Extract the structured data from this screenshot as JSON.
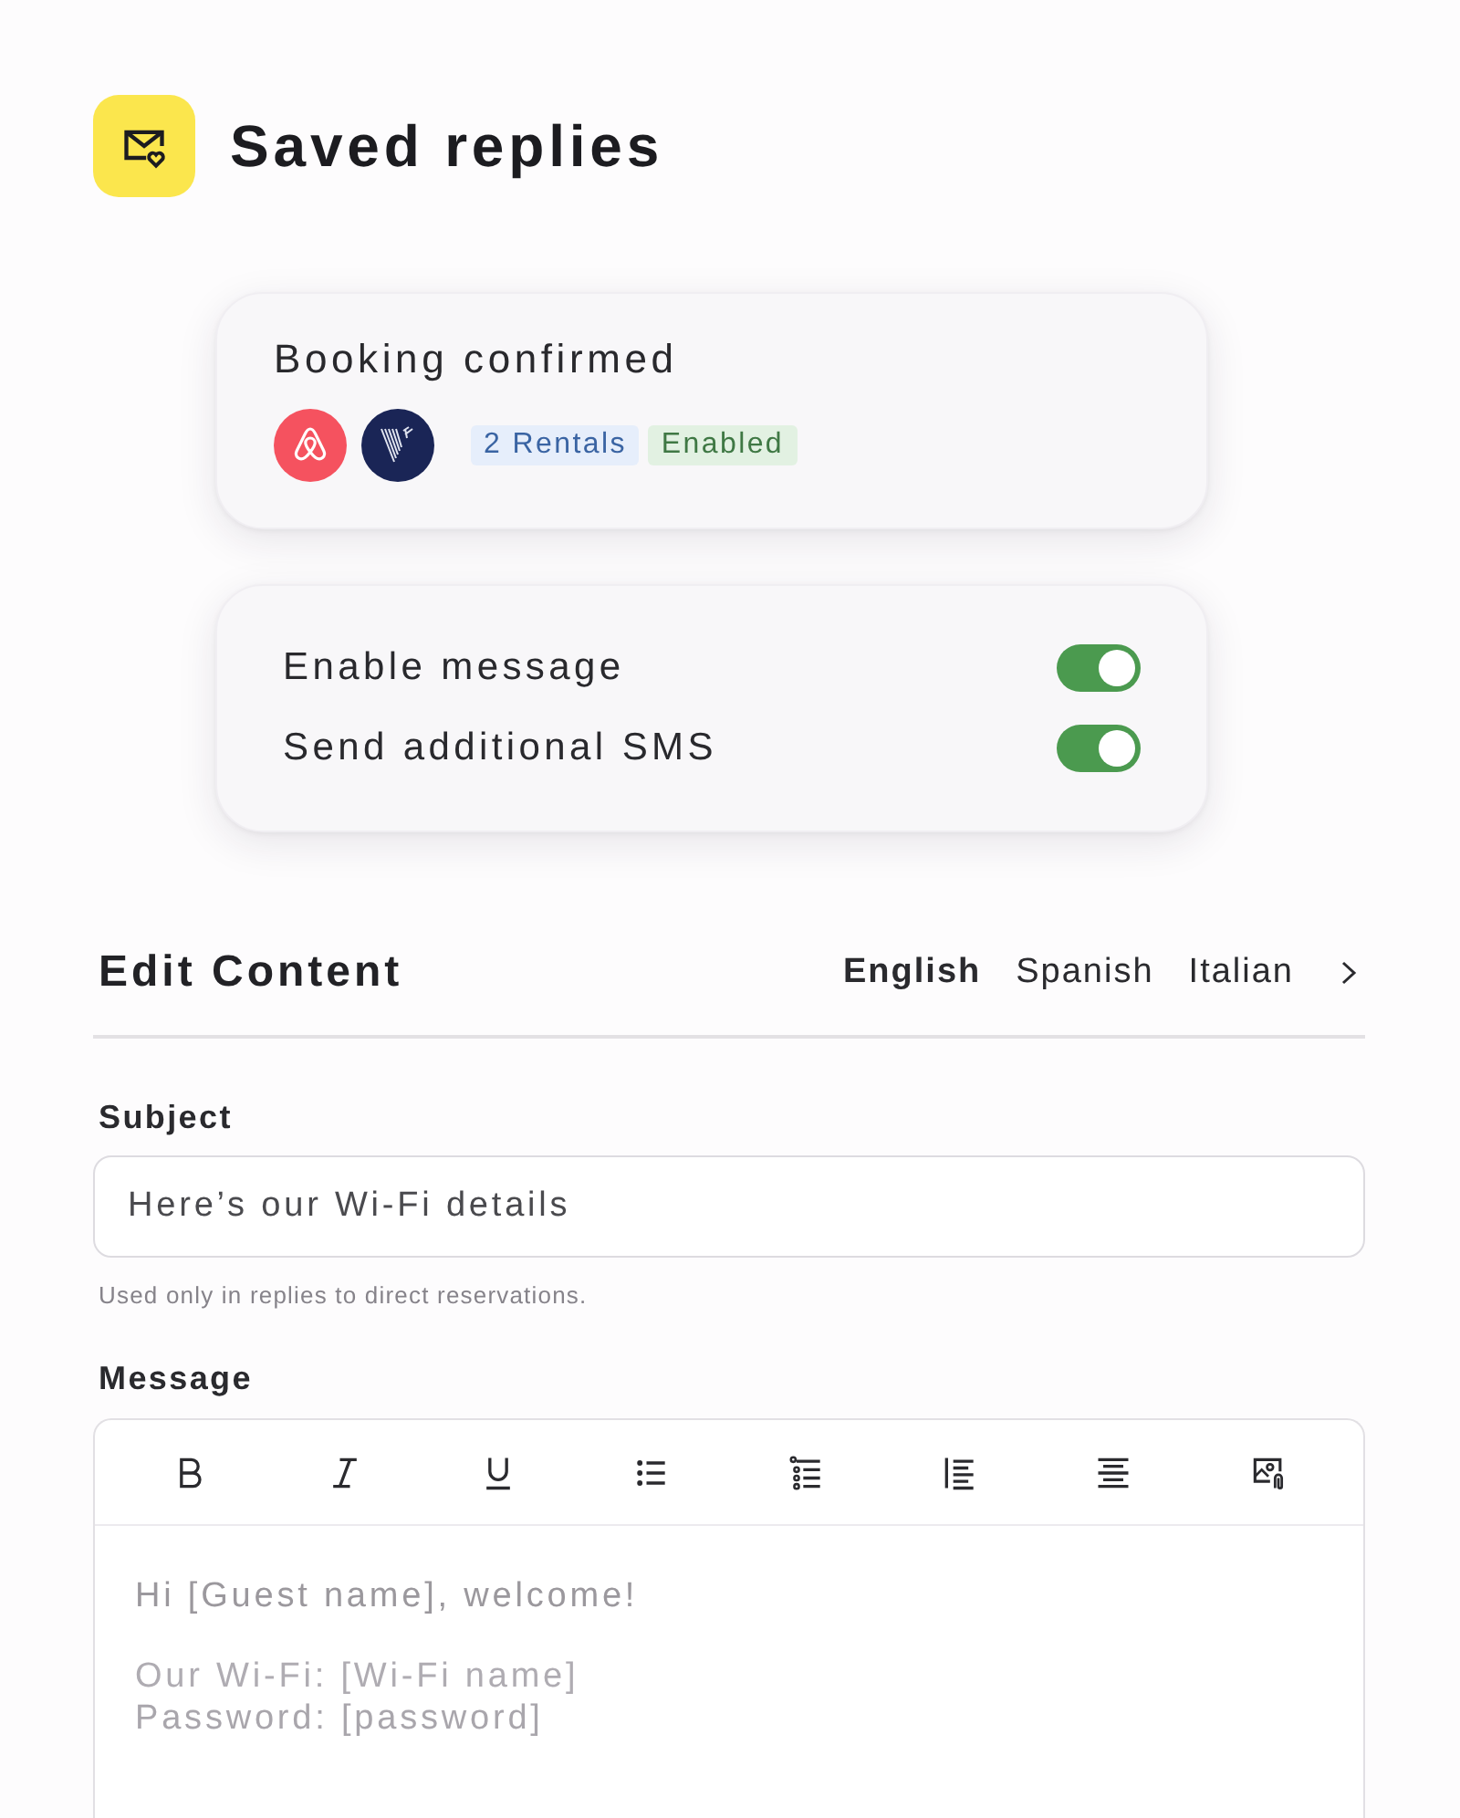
{
  "header": {
    "title": "Saved replies"
  },
  "reply_card": {
    "title": "Booking confirmed",
    "badges": [
      {
        "text": "2 Rentals",
        "kind": "info"
      },
      {
        "text": "Enabled",
        "kind": "success"
      }
    ]
  },
  "settings": [
    {
      "label": "Enable message",
      "on": true
    },
    {
      "label": "Send additional SMS",
      "on": true
    }
  ],
  "editor": {
    "title": "Edit Content",
    "languages": [
      {
        "label": "English",
        "selected": true
      },
      {
        "label": "Spanish",
        "selected": false
      },
      {
        "label": "Italian",
        "selected": false
      }
    ]
  },
  "subject": {
    "label": "Subject",
    "value": "Here’s our Wi-Fi details",
    "hint": "Used only in replies to direct reservations."
  },
  "message": {
    "label": "Message",
    "paragraphs": [
      [
        "Hi [Guest name], welcome!"
      ],
      [
        "Our Wi-Fi: [Wi-Fi name]",
        "Password: [password]"
      ]
    ]
  }
}
